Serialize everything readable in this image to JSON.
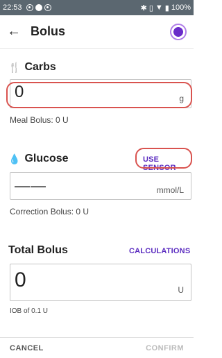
{
  "status_bar": {
    "time": "22:53",
    "battery": "100%"
  },
  "header": {
    "title": "Bolus"
  },
  "carbs": {
    "label": "Carbs",
    "value": "0",
    "unit": "g",
    "meal_bolus": "Meal Bolus: 0 U"
  },
  "glucose": {
    "label": "Glucose",
    "use_sensor": "USE SENSOR",
    "value": "——",
    "unit": "mmol/L",
    "correction_bolus": "Correction Bolus: 0 U"
  },
  "total": {
    "label": "Total Bolus",
    "calculations": "CALCULATIONS",
    "value": "0",
    "unit": "U",
    "iob": "IOB of 0.1 U"
  },
  "footer": {
    "cancel": "CANCEL",
    "confirm": "CONFIRM"
  },
  "colors": {
    "accent": "#5b2cc0",
    "highlight": "#d9534f",
    "status_bar": "#5b6770"
  }
}
